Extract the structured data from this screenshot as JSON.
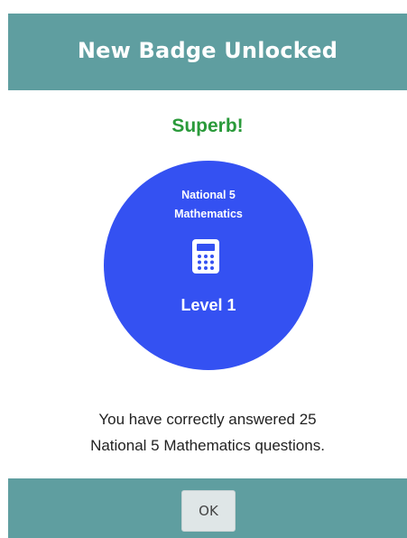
{
  "dialog": {
    "title": "New Badge Unlocked",
    "praise": "Superb!",
    "praise_color": "#2a9a3a",
    "header_color": "#5f9ea0",
    "badge": {
      "subject_line1": "National 5",
      "subject_line2": "Mathematics",
      "icon": "calculator-icon",
      "level": "Level 1",
      "color": "#3451f2"
    },
    "message_line1": "You have correctly answered 25",
    "message_line2": "National 5 Mathematics questions.",
    "ok_label": "OK"
  }
}
